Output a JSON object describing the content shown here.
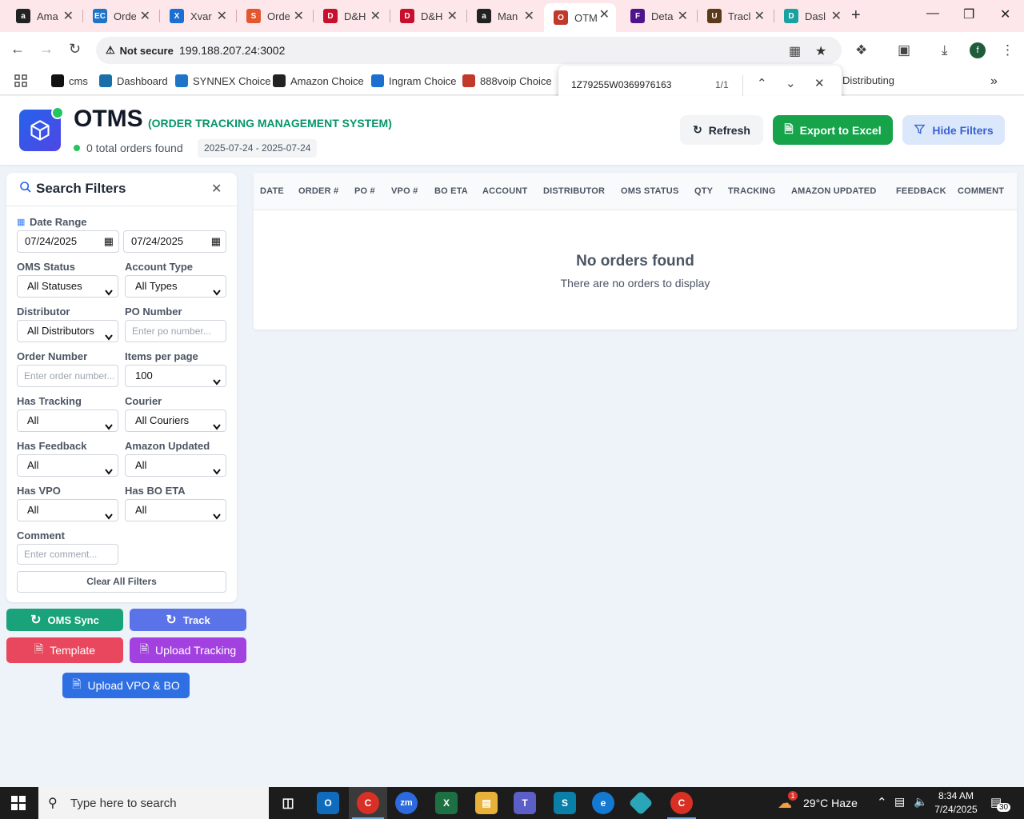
{
  "browser": {
    "tabs": [
      {
        "label": "Ama",
        "icon": "amazon-icon",
        "color": "#222222",
        "glyph": "a"
      },
      {
        "label": "Orde",
        "icon": "ec-icon",
        "color": "#1e74c8",
        "glyph": "EC"
      },
      {
        "label": "Xvar",
        "icon": "xvantage-icon",
        "color": "#1a6fd1",
        "glyph": "X"
      },
      {
        "label": "Orde",
        "icon": "s-icon",
        "color": "#e4572e",
        "glyph": "S"
      },
      {
        "label": "D&H",
        "icon": "dh-icon",
        "color": "#c8102e",
        "glyph": "D"
      },
      {
        "label": "D&H",
        "icon": "dh-icon",
        "color": "#c8102e",
        "glyph": "D"
      },
      {
        "label": "Man",
        "icon": "amazon-icon",
        "color": "#222222",
        "glyph": "a"
      },
      {
        "label": "OTM",
        "icon": "otms-icon",
        "color": "#c0392b",
        "glyph": "O",
        "active": true
      },
      {
        "label": "Deta",
        "icon": "fedex-icon",
        "color": "#4d148c",
        "glyph": "F"
      },
      {
        "label": "Tracl",
        "icon": "ups-icon",
        "color": "#5b3a1a",
        "glyph": "U"
      },
      {
        "label": "Dasl",
        "icon": "dash-icon",
        "color": "#1aa1a1",
        "glyph": "D"
      }
    ],
    "address": {
      "security": "Not secure",
      "url": "199.188.207.24:3002"
    },
    "bookmarks": [
      {
        "label": "cms",
        "icon": "cms-icon",
        "color": "#111111"
      },
      {
        "label": "Dashboard",
        "icon": "dashboard-icon",
        "color": "#1a6fa8"
      },
      {
        "label": "SYNNEX Choice",
        "icon": "ec-icon",
        "color": "#1e74c8"
      },
      {
        "label": "Amazon Choice",
        "icon": "amazon-icon",
        "color": "#222222"
      },
      {
        "label": "Ingram Choice",
        "icon": "ingram-icon",
        "color": "#1a6fd1"
      },
      {
        "label": "888voip Choice",
        "icon": "voip-icon",
        "color": "#c0392b"
      },
      {
        "label": "H Distributing",
        "icon": "dh-icon",
        "color": "#c8102e"
      }
    ],
    "find": {
      "query": "1Z79255W0369976163",
      "count": "1/1"
    }
  },
  "header": {
    "title": "OTMS",
    "subtitle": "(ORDER TRACKING MANAGEMENT SYSTEM)",
    "order_count": "0 total orders found",
    "date_range": "2025-07-24 - 2025-07-24",
    "refresh_label": "Refresh",
    "export_label": "Export to Excel",
    "hide_filters_label": "Hide Filters"
  },
  "filters": {
    "title": "Search Filters",
    "date_range_label": "Date Range",
    "date_from": "07/24/2025",
    "date_to": "07/24/2025",
    "oms_status_label": "OMS Status",
    "oms_status_value": "All Statuses",
    "account_type_label": "Account Type",
    "account_type_value": "All Types",
    "distributor_label": "Distributor",
    "distributor_value": "All Distributors",
    "po_number_label": "PO Number",
    "po_number_placeholder": "Enter po number...",
    "order_number_label": "Order Number",
    "order_number_placeholder": "Enter order number...",
    "items_per_page_label": "Items per page",
    "items_per_page_value": "100",
    "has_tracking_label": "Has Tracking",
    "has_tracking_value": "All",
    "courier_label": "Courier",
    "courier_value": "All Couriers",
    "has_feedback_label": "Has Feedback",
    "has_feedback_value": "All",
    "amazon_updated_label": "Amazon Updated",
    "amazon_updated_value": "All",
    "has_vpo_label": "Has VPO",
    "has_vpo_value": "All",
    "has_bo_eta_label": "Has BO ETA",
    "has_bo_eta_value": "All",
    "comment_label": "Comment",
    "comment_placeholder": "Enter comment...",
    "clear_label": "Clear All Filters"
  },
  "actions": {
    "oms_sync": "OMS Sync",
    "track": "Track",
    "template": "Template",
    "upload_tracking": "Upload Tracking",
    "upload_vpo_bo": "Upload VPO & BO"
  },
  "table": {
    "columns": [
      "DATE",
      "ORDER #",
      "PO #",
      "VPO #",
      "BO ETA",
      "ACCOUNT",
      "DISTRIBUTOR",
      "OMS STATUS",
      "QTY",
      "TRACKING",
      "AMAZON UPDATED",
      "FEEDBACK",
      "COMMENT"
    ],
    "empty_title": "No orders found",
    "empty_message": "There are no orders to display"
  },
  "taskbar": {
    "search_placeholder": "Type here to search",
    "weather": "29°C  Haze",
    "time": "8:34 AM",
    "date": "7/24/2025",
    "notification_count": "30",
    "weather_badge": "1"
  },
  "colors": {
    "accent": "#2563eb",
    "success": "#16a34a",
    "subtitle": "#059669",
    "oms_sync": "#1aa37a",
    "track": "#5b73e8",
    "template": "#e9475d",
    "upload_tracking": "#a341e0",
    "upload_vpo": "#2f6fe4"
  }
}
